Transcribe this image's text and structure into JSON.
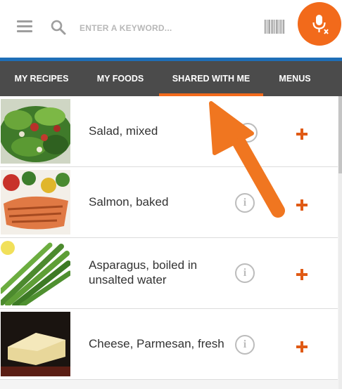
{
  "header": {
    "search_placeholder": "ENTER A KEYWORD...",
    "menu_icon": "hamburger-menu-icon",
    "search_icon": "magnifier-icon",
    "barcode_icon": "barcode-scanner-icon",
    "mic_icon": "microphone-off-icon",
    "accent_color": "#f26a1b"
  },
  "tabs": [
    {
      "label": "MY RECIPES",
      "active": false
    },
    {
      "label": "MY FOODS",
      "active": false
    },
    {
      "label": "SHARED WITH ME",
      "active": true
    },
    {
      "label": "MENUS",
      "active": false
    }
  ],
  "foods": [
    {
      "name": "Salad, mixed",
      "image": "salad-photo"
    },
    {
      "name": "Salmon, baked",
      "image": "salmon-photo"
    },
    {
      "name": "Asparagus, boiled in unsalted water",
      "image": "asparagus-photo"
    },
    {
      "name": "Cheese, Parmesan, fresh",
      "image": "parmesan-photo"
    }
  ],
  "colors": {
    "tab_bar": "#4b4b4b",
    "blue_stripe": "#1e6eb7",
    "add_icon": "#e05a15",
    "annotation_arrow": "#f26a1b"
  }
}
